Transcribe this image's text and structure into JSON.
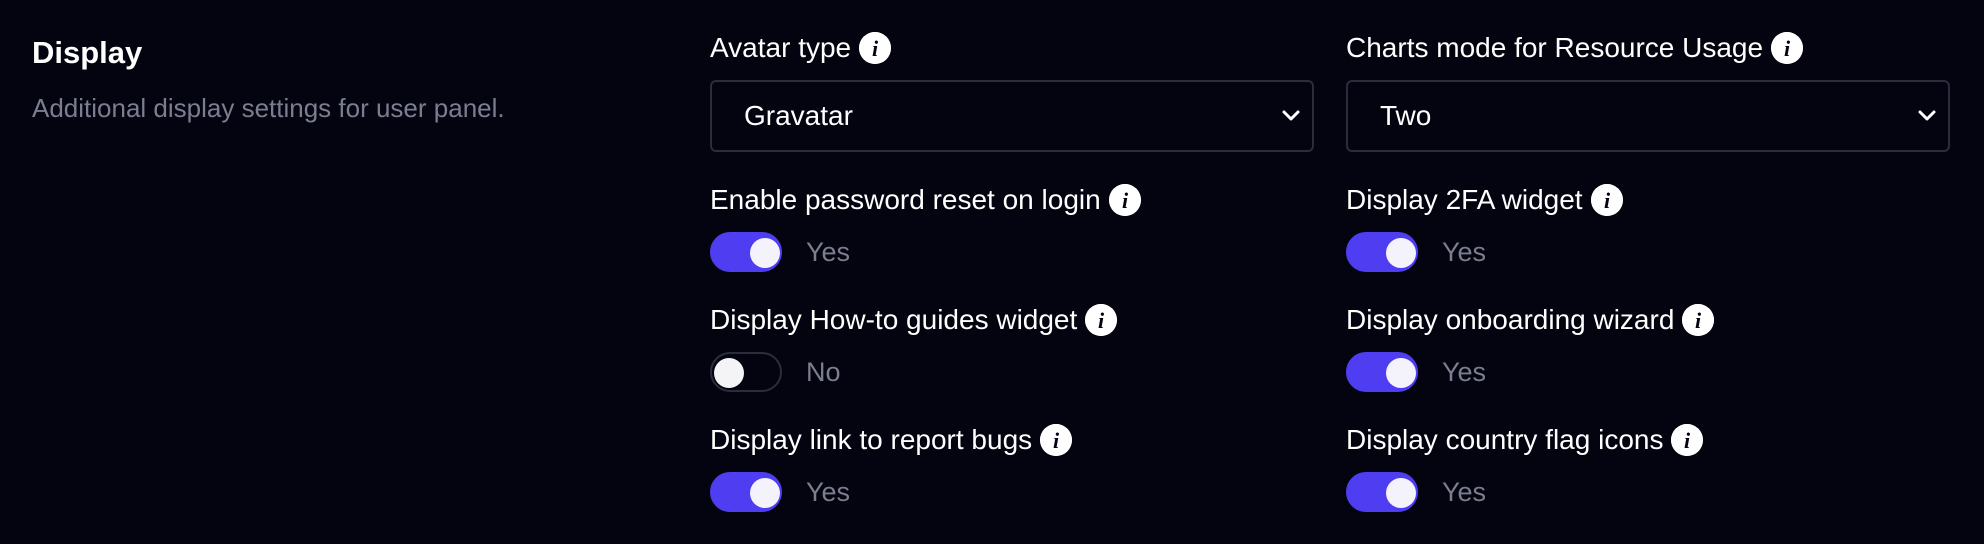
{
  "section": {
    "title": "Display",
    "description": "Additional display settings for user panel."
  },
  "left": {
    "avatar_type": {
      "label": "Avatar type",
      "value": "Gravatar"
    },
    "password_reset": {
      "label": "Enable password reset on login",
      "state": "Yes",
      "on": true
    },
    "howto_widget": {
      "label": "Display How-to guides widget",
      "state": "No",
      "on": false
    },
    "report_bugs": {
      "label": "Display link to report bugs",
      "state": "Yes",
      "on": true
    }
  },
  "right": {
    "charts_mode": {
      "label": "Charts mode for Resource Usage",
      "value": "Two"
    },
    "twofa_widget": {
      "label": "Display 2FA widget",
      "state": "Yes",
      "on": true
    },
    "onboarding_wizard": {
      "label": "Display onboarding wizard",
      "state": "Yes",
      "on": true
    },
    "country_flags": {
      "label": "Display country flag icons",
      "state": "Yes",
      "on": true
    }
  },
  "icons": {
    "info": "info-icon",
    "select": "chevron-down-icon"
  },
  "colors": {
    "background": "#03040f",
    "toggle_on": "#4f3df2",
    "muted_text": "#7b7e91",
    "border": "#2a2d3d"
  }
}
